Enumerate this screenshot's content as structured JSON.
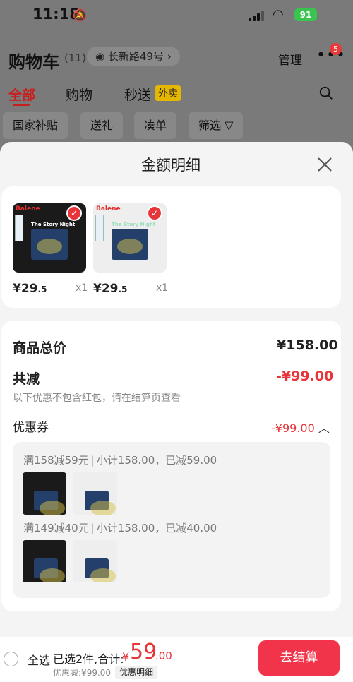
{
  "status_bar": {
    "time": "11:18",
    "battery": "91"
  },
  "header": {
    "title": "购物车",
    "count": "(11)",
    "address": "长新路49号",
    "manage": "管理",
    "badge": "5"
  },
  "tabs": [
    {
      "label": "全部",
      "active": true
    },
    {
      "label": "购物"
    },
    {
      "label": "秒送"
    }
  ],
  "takeout_tag": "外卖",
  "chips": [
    "国家补贴",
    "送礼",
    "凑单",
    "筛选"
  ],
  "sheet": {
    "title": "金额明细",
    "products": [
      {
        "brand": "Balene",
        "print": "The Story Night",
        "price_int": "¥29",
        "price_dec": ".5",
        "qty": "x1",
        "color": "black"
      },
      {
        "brand": "Balene",
        "print": "The Story Night",
        "price_int": "¥29",
        "price_dec": ".5",
        "qty": "x1",
        "color": "white"
      }
    ],
    "summary": {
      "total_label": "商品总价",
      "total_value": "¥158.00",
      "reduce_label": "共减",
      "reduce_value": "-¥99.00",
      "note": "以下优惠不包含红包，请在结算页查看",
      "coupon_label": "优惠券",
      "coupon_value": "-¥99.00"
    },
    "coupons": [
      {
        "rule": "满158减59元",
        "detail": "小计158.00，已减59.00"
      },
      {
        "rule": "满149减40元",
        "detail": "小计158.00，已减40.00"
      }
    ]
  },
  "bottom_bar": {
    "select_all": "全选",
    "selected_text": "已选2件,合计:",
    "currency": "¥",
    "total_int": "59",
    "total_dec": ".00",
    "discount_note": "优惠减:¥99.00",
    "detail_tag": "优惠明细",
    "checkout": "去结算"
  },
  "colors": {
    "accent": "#e8353a",
    "checkout": "#f2344a",
    "active_tab": "#c81e1e"
  }
}
